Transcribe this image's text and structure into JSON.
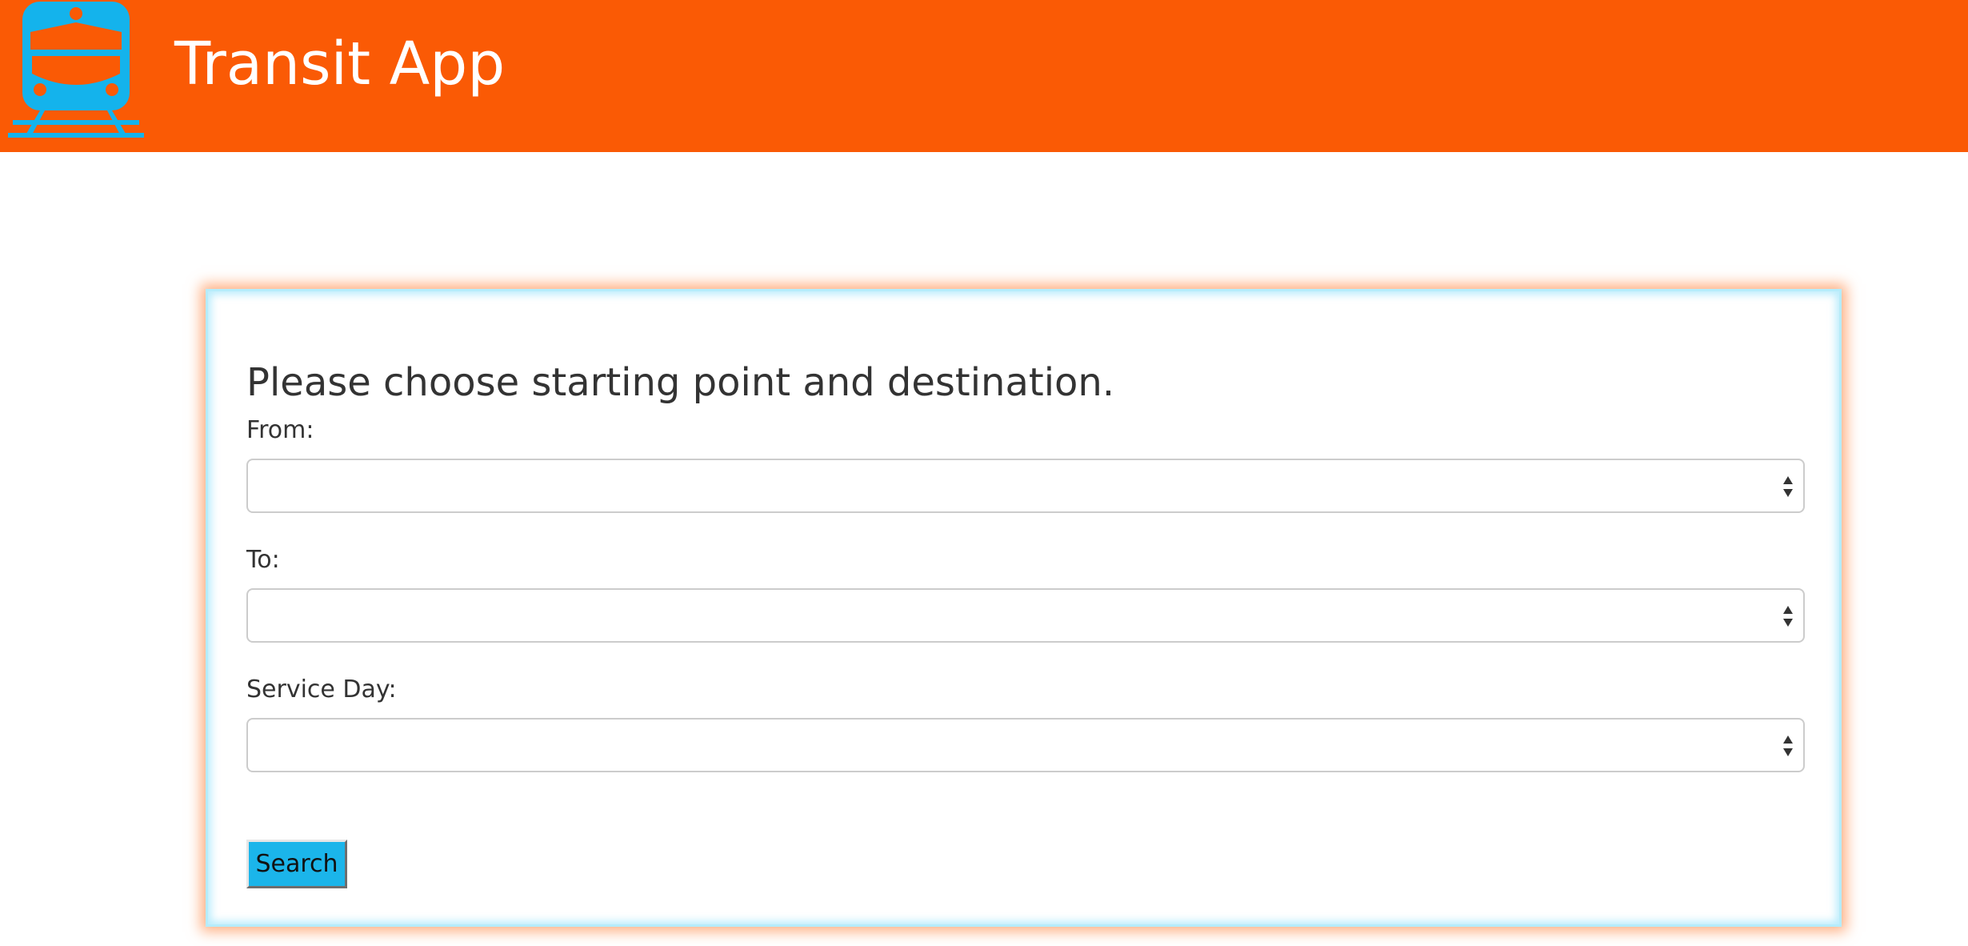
{
  "header": {
    "title": "Transit App",
    "logo_icon": "train-icon",
    "background_color": "#fa5a05",
    "logo_color": "#14b3ec"
  },
  "form": {
    "prompt": "Please choose starting point and destination.",
    "from": {
      "label": "From:",
      "value": ""
    },
    "to": {
      "label": "To:",
      "value": ""
    },
    "service_day": {
      "label": "Service Day:",
      "value": ""
    },
    "search_label": "Search",
    "search_button_color": "#1bb5ea",
    "select_icon": "updown-arrows-icon"
  }
}
